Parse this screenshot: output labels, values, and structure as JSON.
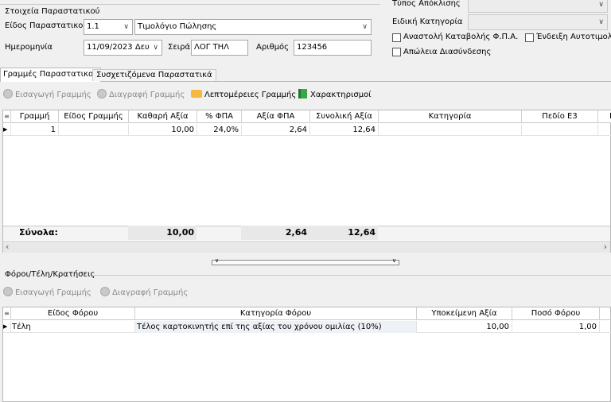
{
  "header": {
    "group_title": "Στοιχεία Παραστατικού",
    "doc_type_label": "Είδος Παραστατικού",
    "doc_type_code": "1.1",
    "doc_type_name": "Τιμολόγιο Πώλησης",
    "date_label": "Ημερομηνία",
    "date_value": "11/09/2023 Δευ",
    "series_label": "Σειρά",
    "series_value": "ΛΟΓ ΤΗΛ",
    "number_label": "Αριθμός",
    "number_value": "123456",
    "exemption_label": "Τύπος Απόκλισης",
    "special_category_label": "Ειδική Κατηγορία",
    "vat_suspension_label": "Αναστολή Καταβολής Φ.Π.Α.",
    "self_invoice_label": "Ένδειξη Αυτοτιμολ.",
    "connection_loss_label": "Απώλεια Διασύνδεσης"
  },
  "tabs": [
    "Γραμμές Παραστατικού",
    "Συσχετιζόμενα Παραστατικά"
  ],
  "lines_toolbar": {
    "insert": "Εισαγωγή Γραμμής",
    "delete": "Διαγραφή Γραμμής",
    "details": "Λεπτομέρειες Γραμμής",
    "characterizations": "Χαρακτηρισμοί"
  },
  "lines_grid": {
    "columns": [
      "Γραμμή",
      "Είδος Γραμμής",
      "Καθαρή Αξία",
      "% ΦΠΑ",
      "Αξία ΦΠΑ",
      "Συνολική Αξία",
      "Κατηγορία",
      "Πεδίο Ε3",
      "Π"
    ],
    "row": {
      "line": "1",
      "type": "",
      "net": "10,00",
      "vat_pct": "24,0%",
      "vat": "2,64",
      "total": "12,64"
    },
    "totals_label": "Σύνολα:",
    "totals": {
      "net": "10,00",
      "vat": "2,64",
      "total": "12,64"
    }
  },
  "taxes": {
    "title": "Φόροι/Τέλη/Κρατήσεις",
    "insert": "Εισαγωγή Γραμμής",
    "delete": "Διαγραφή Γραμμής",
    "columns": [
      "Είδος Φόρου",
      "Κατηγορία Φόρου",
      "Υποκείμενη Αξία",
      "Ποσό Φόρου"
    ],
    "row": {
      "type": "Τέλη",
      "category": "Τέλος καρτοκινητής επί της αξίας του χρόνου ομιλίας (10%)",
      "base": "10,00",
      "amount": "1,00"
    }
  },
  "colors": {
    "accent": "#1c5fb5",
    "folder": "#f4b93e",
    "book": "#3aa64a"
  }
}
